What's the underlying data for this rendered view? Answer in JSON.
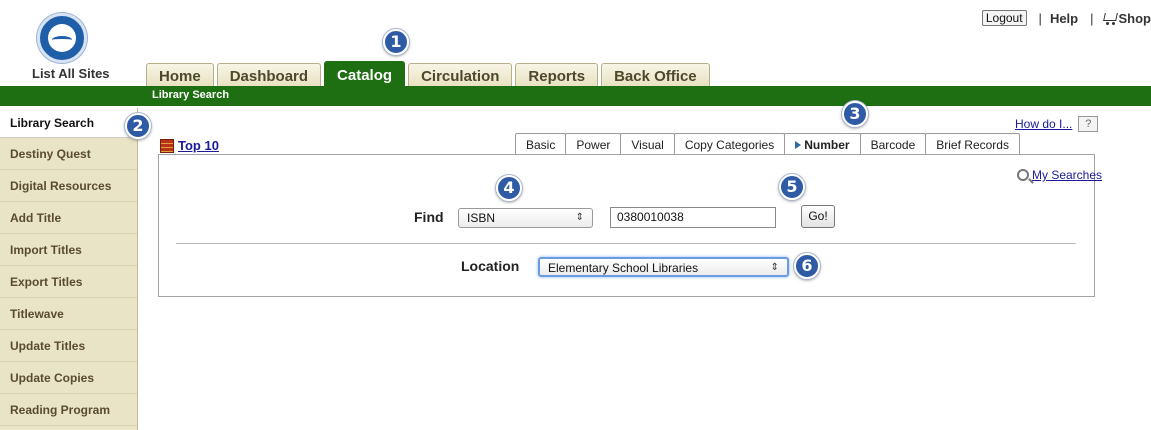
{
  "header": {
    "site_link": "List All Sites",
    "logout": "Logout",
    "help": "Help",
    "shop": "Shop",
    "separator": "|"
  },
  "main_tabs": [
    {
      "label": "Home",
      "active": false
    },
    {
      "label": "Dashboard",
      "active": false
    },
    {
      "label": "Catalog",
      "active": true
    },
    {
      "label": "Circulation",
      "active": false
    },
    {
      "label": "Reports",
      "active": false
    },
    {
      "label": "Back Office",
      "active": false
    }
  ],
  "subnav": {
    "label": "Library Search"
  },
  "sidebar": {
    "items": [
      {
        "label": "Library Search",
        "active": true
      },
      {
        "label": "Destiny Quest"
      },
      {
        "label": "Digital Resources"
      },
      {
        "label": "Add Title"
      },
      {
        "label": "Import Titles"
      },
      {
        "label": "Export Titles"
      },
      {
        "label": "Titlewave"
      },
      {
        "label": "Update Titles"
      },
      {
        "label": "Update Copies"
      },
      {
        "label": "Reading Program"
      }
    ]
  },
  "callouts": [
    "1",
    "2",
    "3",
    "4",
    "5",
    "6"
  ],
  "content": {
    "top10": "Top 10",
    "how_do_i": "How do I...",
    "help_button": "?",
    "my_searches": "My Searches",
    "search_tabs": [
      {
        "label": "Basic"
      },
      {
        "label": "Power"
      },
      {
        "label": "Visual"
      },
      {
        "label": "Copy Categories"
      },
      {
        "label": "Number",
        "active": true
      },
      {
        "label": "Barcode"
      },
      {
        "label": "Brief Records"
      }
    ],
    "find_label": "Find",
    "find_type": "ISBN",
    "find_value": "0380010038",
    "go_label": "Go!",
    "location_label": "Location",
    "location_value": "Elementary School Libraries"
  },
  "colors": {
    "green_bar": "#1e6e12",
    "sidebar_bg": "#eae4c6",
    "callout_blue": "#2f5aa5",
    "link_blue": "#1a1a9a"
  },
  "icons": [
    "school-seal-logo",
    "cart-icon",
    "books-icon",
    "help-icon",
    "magnifier-icon",
    "select-arrow-icon",
    "active-tab-triangle-icon"
  ]
}
